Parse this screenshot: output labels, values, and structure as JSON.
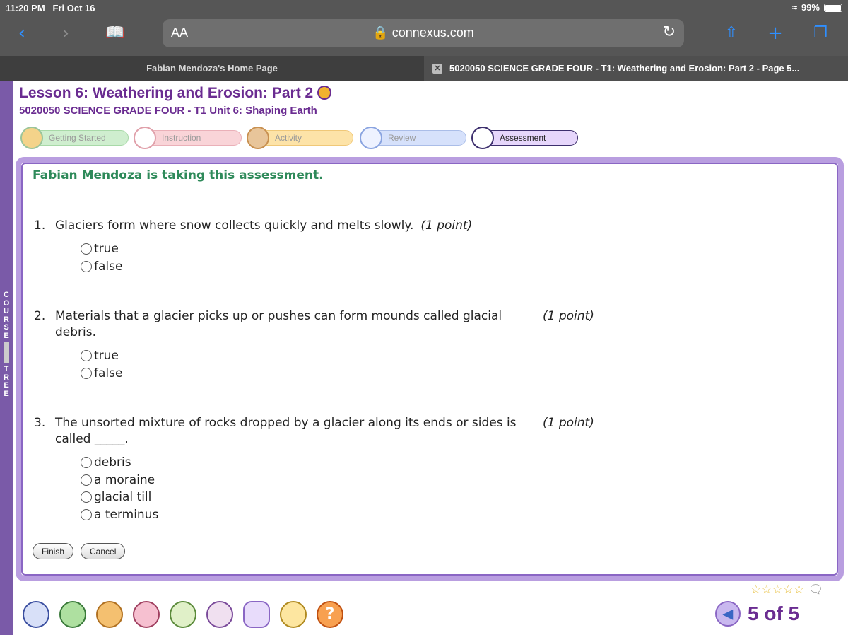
{
  "status_bar": {
    "time": "11:20 PM",
    "date": "Fri Oct 16",
    "battery": "99%"
  },
  "browser": {
    "aa_label": "AA",
    "url": "connexus.com",
    "tabs": [
      {
        "label": "Fabian Mendoza's Home Page"
      },
      {
        "label": "5020050 SCIENCE GRADE FOUR - T1: Weathering and Erosion: Part 2 - Page 5..."
      }
    ]
  },
  "course_tree": {
    "letters_top": "COURSE",
    "letters_bottom": "TREE"
  },
  "lesson": {
    "title": "Lesson 6: Weathering and Erosion: Part 2",
    "subtitle": "5020050 SCIENCE GRADE FOUR - T1  Unit 6: Shaping Earth"
  },
  "steps": [
    {
      "label": "Getting Started",
      "color": "#cfeecf"
    },
    {
      "label": "Instruction",
      "color": "#f9d4d8"
    },
    {
      "label": "Activity",
      "color": "#fde3a8"
    },
    {
      "label": "Review",
      "color": "#d6e1fb"
    },
    {
      "label": "Assessment",
      "color": "#e6d6fb"
    }
  ],
  "assessment": {
    "status": "Fabian Mendoza is taking this assessment.",
    "questions": [
      {
        "number": "1.",
        "text": "Glaciers form where snow collects quickly and melts slowly.",
        "points": "(1 point)",
        "options": [
          "true",
          "false"
        ]
      },
      {
        "number": "2.",
        "text": "Materials that a glacier picks up or pushes can form mounds called glacial debris.",
        "points": "(1 point)",
        "options": [
          "true",
          "false"
        ]
      },
      {
        "number": "3.",
        "text": "The unsorted mixture of rocks dropped by a glacier along its ends or sides is called _____.",
        "points": "(1 point)",
        "options": [
          "debris",
          "a moraine",
          "glacial till",
          "a terminus"
        ]
      }
    ],
    "finish_label": "Finish",
    "cancel_label": "Cancel"
  },
  "footer": {
    "page_count": "5 of 5"
  }
}
